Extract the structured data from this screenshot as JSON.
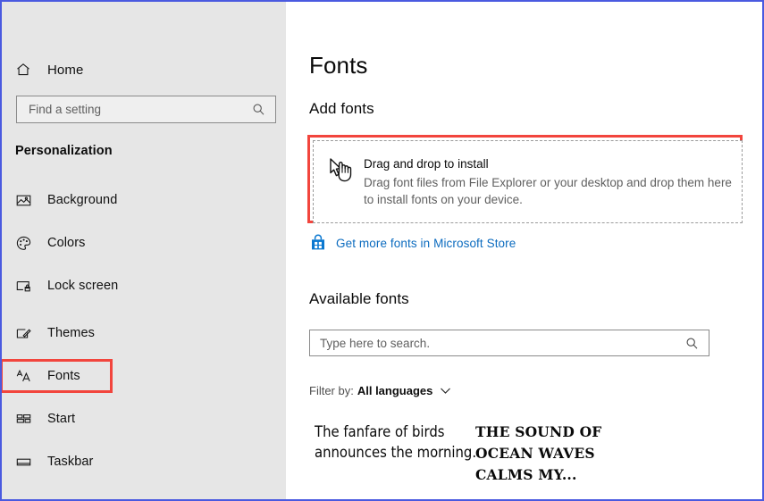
{
  "window": {
    "app_title": "Settings",
    "border_color": "#4a5ae0",
    "sidebar_bg": "#e6e6e6",
    "accent_link_color": "#0b6bbf",
    "annotation_color": "#f2453d"
  },
  "sidebar": {
    "home": {
      "label": "Home",
      "icon": "home-icon"
    },
    "search": {
      "placeholder": "Find a setting",
      "value": "",
      "icon": "search-icon"
    },
    "section_header": "Personalization",
    "items": [
      {
        "label": "Background",
        "icon": "picture-icon",
        "selected": false
      },
      {
        "label": "Colors",
        "icon": "palette-icon",
        "selected": false
      },
      {
        "label": "Lock screen",
        "icon": "lock-screen-icon",
        "selected": false
      },
      {
        "label": "Themes",
        "icon": "brush-icon",
        "selected": false
      },
      {
        "label": "Fonts",
        "icon": "font-size-icon",
        "selected": true
      },
      {
        "label": "Start",
        "icon": "start-grid-icon",
        "selected": false
      },
      {
        "label": "Taskbar",
        "icon": "taskbar-icon",
        "selected": false
      }
    ]
  },
  "main": {
    "page_title": "Fonts",
    "add_fonts": {
      "heading": "Add fonts",
      "drop_zone": {
        "icon": "drag-hand-cursor-icon",
        "title": "Drag and drop to install",
        "subtitle": "Drag font files from File Explorer or your desktop and drop them here to install fonts on your device."
      },
      "store_link": {
        "icon": "microsoft-store-icon",
        "label": "Get more fonts in Microsoft Store"
      }
    },
    "available_fonts": {
      "heading": "Available fonts",
      "search": {
        "placeholder": "Type here to search.",
        "value": "",
        "icon": "search-icon"
      },
      "filter": {
        "label": "Filter by:",
        "value": "All languages",
        "icon": "chevron-down-icon"
      },
      "previews": [
        {
          "text": "The fanfare of birds announces the morning."
        },
        {
          "text": "THE SOUND OF OCEAN WAVES CALMS MY..."
        }
      ]
    }
  }
}
